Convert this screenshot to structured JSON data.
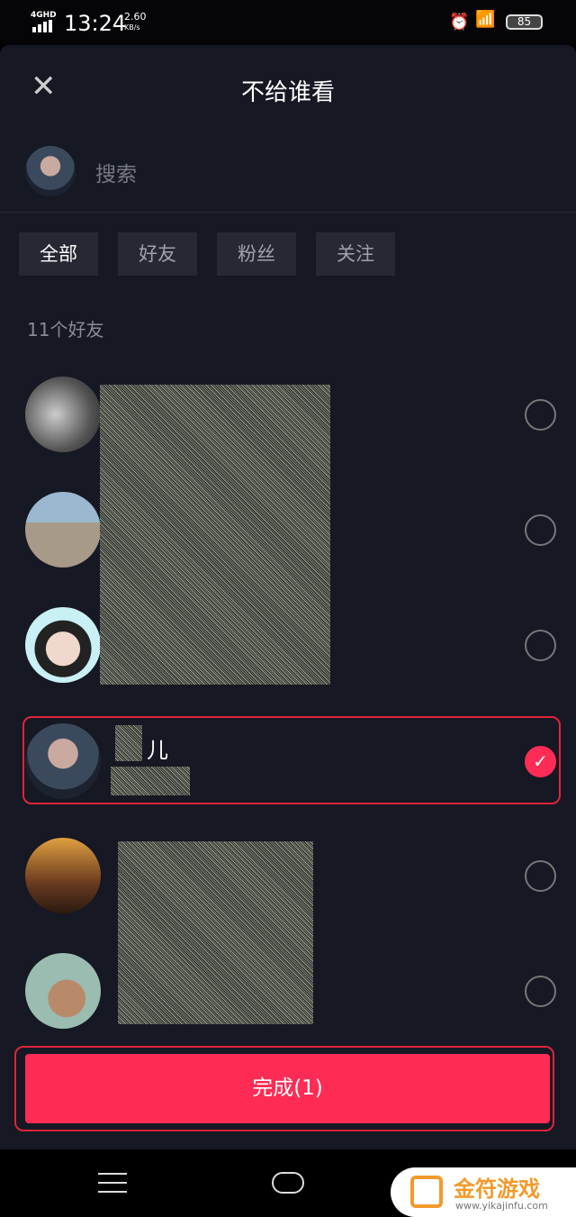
{
  "status": {
    "network": "4GHD",
    "time": "13:24",
    "speed": "2.60",
    "speed_unit": "KB/s",
    "battery": "85"
  },
  "header": {
    "title": "不给谁看",
    "close_icon": "close-icon"
  },
  "search": {
    "placeholder": "搜索"
  },
  "tabs": [
    {
      "label": "全部",
      "active": true
    },
    {
      "label": "好友"
    },
    {
      "label": "粉丝"
    },
    {
      "label": "关注"
    }
  ],
  "list": {
    "count_label": "11个好友",
    "items": [
      {
        "selected": false
      },
      {
        "selected": false
      },
      {
        "selected": false
      },
      {
        "name": "儿",
        "selected": true
      },
      {
        "selected": false
      },
      {
        "selected": false
      }
    ]
  },
  "done_button": "完成(1)",
  "accent": "#fe2c55",
  "watermark": {
    "text": "金符游戏",
    "url": "www.yikajinfu.com"
  }
}
